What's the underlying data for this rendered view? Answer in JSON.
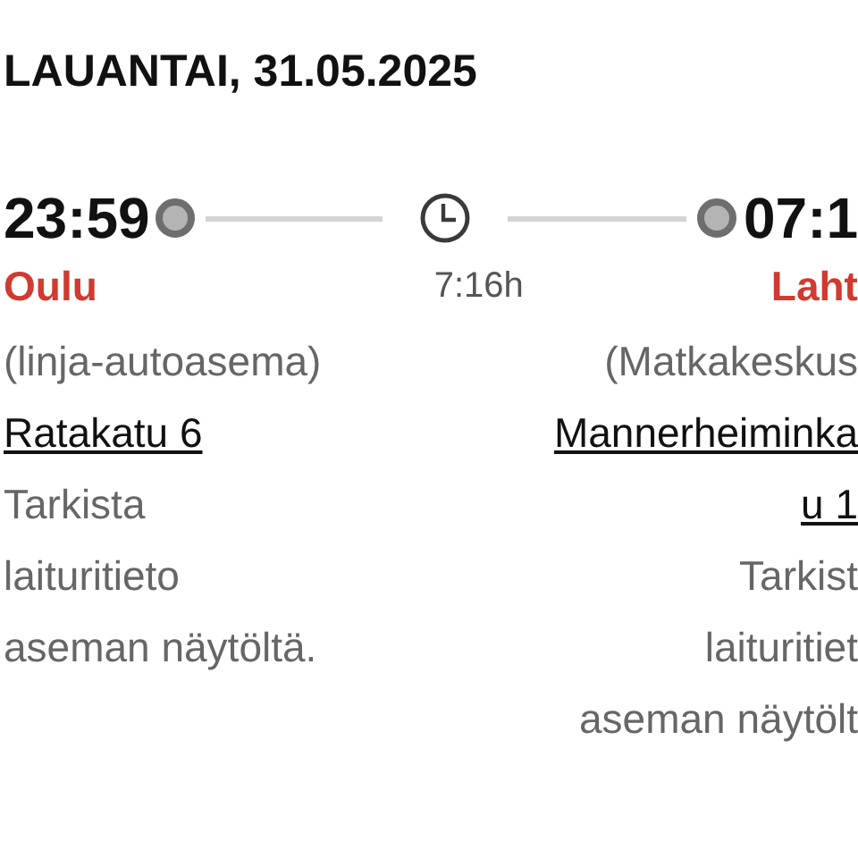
{
  "date_header": "LAUANTAI, 31.05.2025",
  "departure": {
    "time": "23:59",
    "city": "Oulu",
    "station": "(linja-autoasema)",
    "address_lines": [
      "Ratakatu 6"
    ],
    "note_lines": [
      "Tarkista",
      "laituritieto",
      "aseman näytöltä."
    ]
  },
  "duration": "7:16h",
  "arrival": {
    "time": "07:1",
    "city": "Laht",
    "station": "(Matkakeskus",
    "address_lines": [
      "Mannerheiminka",
      "u 1"
    ],
    "note_lines": [
      "Tarkist",
      "laituritiet",
      "aseman näytölt"
    ]
  }
}
